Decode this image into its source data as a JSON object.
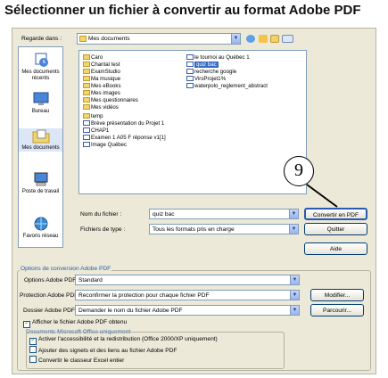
{
  "page_title": "Sélectionner un fichier à convertir au format Adobe PDF",
  "callout_number": "9",
  "look_in": {
    "label": "Regarde dans :",
    "value": "Mes documents"
  },
  "places": [
    {
      "label": "Mes documents récents",
      "icon": "recent-documents-icon"
    },
    {
      "label": "Bureau",
      "icon": "desktop-icon"
    },
    {
      "label": "Mes documents",
      "icon": "my-documents-icon"
    },
    {
      "label": "Poste de travail",
      "icon": "my-computer-icon"
    },
    {
      "label": "Favoris réseau",
      "icon": "network-places-icon"
    }
  ],
  "files_col1": [
    {
      "name": "Caro",
      "kind": "folder"
    },
    {
      "name": "Chantal test",
      "kind": "folder"
    },
    {
      "name": "ExamStudio",
      "kind": "folder"
    },
    {
      "name": "Ma musique",
      "kind": "folder"
    },
    {
      "name": "Mes eBooks",
      "kind": "folder"
    },
    {
      "name": "Mes images",
      "kind": "folder"
    },
    {
      "name": "Mes questionnaires",
      "kind": "folder"
    },
    {
      "name": "Mes vidéos",
      "kind": "folder"
    },
    {
      "name": "temp",
      "kind": "folder"
    },
    {
      "name": "Brève présentation du Projet 1",
      "kind": "doc"
    },
    {
      "name": "CHAP1",
      "kind": "doc"
    },
    {
      "name": "Examen 1 A05 F réponse v1[1]",
      "kind": "doc"
    },
    {
      "name": "Image Québec",
      "kind": "doc"
    }
  ],
  "files_col2": [
    {
      "name": "le tournoi au Québec 1",
      "kind": "doc"
    },
    {
      "name": "quiz bac",
      "kind": "doc",
      "selected": true
    },
    {
      "name": "recherche google",
      "kind": "doc"
    },
    {
      "name": "VirsProjet1%",
      "kind": "doc"
    },
    {
      "name": "waterpolo_reglement_abstract",
      "kind": "doc"
    }
  ],
  "file_name": {
    "label": "Nom du fichier :",
    "value": "quiz bac"
  },
  "file_type": {
    "label": "Fichiers de type :",
    "value": "Tous les formats pris en charge"
  },
  "buttons": {
    "convert": "Convertir en PDF",
    "quit": "Quitter",
    "help": "Aide",
    "modify": "Modifier...",
    "browse": "Parcourir..."
  },
  "options_group_title": "Options de conversion Adobe PDF",
  "pdf_options": {
    "label": "Options Adobe PDF :",
    "value": "Standard"
  },
  "pdf_protection": {
    "label": "Protection Adobe PDF :",
    "value": "Reconfirmer la protection pour chaque fichier PDF"
  },
  "pdf_folder": {
    "label": "Dossier Adobe PDF :",
    "value": "Demander le nom du fichier Adobe PDF"
  },
  "show_result": {
    "label": "Afficher le fichier Adobe PDF obtenu",
    "checked": true
  },
  "office_group_title": "Documents Microsoft Office uniquement",
  "office_options": [
    {
      "label": "Activer l'accessibilité et la redistribution (Office 2000/XP uniquement)",
      "checked": true
    },
    {
      "label": "Ajouter des signets et des liens au fichier Adobe PDF",
      "checked": false
    },
    {
      "label": "Convertir le classeur Excel entier",
      "checked": false
    }
  ],
  "colors": {
    "dialog_bg": "#ece9d8",
    "selection": "#316ac5",
    "option_label_blue": "#1f5fa8"
  }
}
